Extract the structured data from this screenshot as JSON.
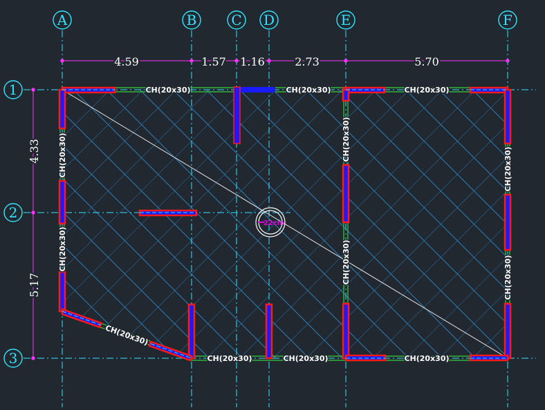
{
  "grid": {
    "vertical": [
      "A",
      "B",
      "C",
      "D",
      "E",
      "F"
    ],
    "horizontal": [
      "1",
      "2",
      "3"
    ]
  },
  "dimensions": {
    "horizontal": [
      "4.59",
      "1.57",
      "1.16",
      "2.73",
      "5.70"
    ],
    "vertical": [
      "4.33",
      "5.17"
    ]
  },
  "beams": {
    "label": "CH(20x30)"
  },
  "slab": {
    "thickness_label": "22cm"
  },
  "colors": {
    "background": "#212830",
    "grid": "#33e5ff",
    "dimension": "#ff33ff",
    "beam": "#3ad13a",
    "column_outline": "#ff1a1a",
    "column_fill": "#1a1aff",
    "hatch": "#2e8fd6"
  }
}
